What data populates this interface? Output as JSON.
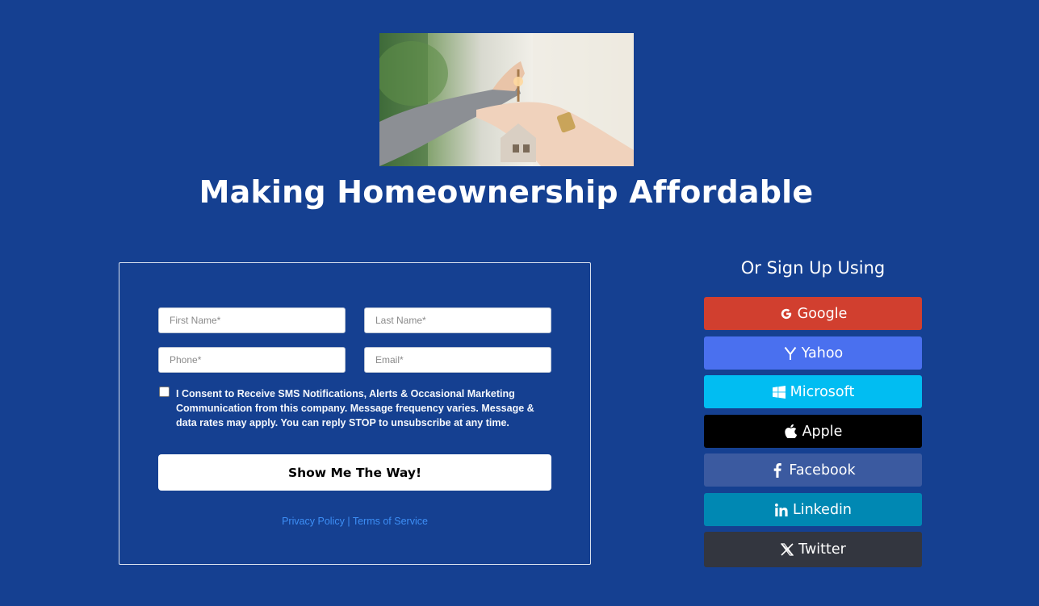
{
  "page": {
    "title": "Making Homeownership Affordable"
  },
  "form": {
    "first_name_placeholder": "First Name*",
    "last_name_placeholder": "Last Name*",
    "phone_placeholder": "Phone*",
    "email_placeholder": "Email*",
    "consent_text": "I Consent to Receive SMS Notifications, Alerts & Occasional Marketing Communication from this company. Message frequency varies. Message & data rates may apply. You can reply STOP to unsubscribe at any time.",
    "consent_checked": false,
    "submit_label": "Show Me The Way!",
    "privacy_label": "Privacy Policy",
    "separator": "|",
    "terms_label": "Terms of Service"
  },
  "signup": {
    "heading": "Or Sign Up Using",
    "providers": [
      {
        "label": "Google",
        "icon": "google-icon",
        "color": "#d13f2f"
      },
      {
        "label": "Yahoo",
        "icon": "yahoo-icon",
        "color": "#4a70ef"
      },
      {
        "label": "Microsoft",
        "icon": "windows-icon",
        "color": "#01bdf2"
      },
      {
        "label": "Apple",
        "icon": "apple-icon",
        "color": "#000000"
      },
      {
        "label": "Facebook",
        "icon": "facebook-icon",
        "color": "#3b5aa0"
      },
      {
        "label": "Linkedin",
        "icon": "linkedin-icon",
        "color": "#0088b3"
      },
      {
        "label": "Twitter",
        "icon": "x-icon",
        "color": "#33363f"
      }
    ]
  },
  "colors": {
    "background": "#154091",
    "link": "#3d8ef5"
  }
}
